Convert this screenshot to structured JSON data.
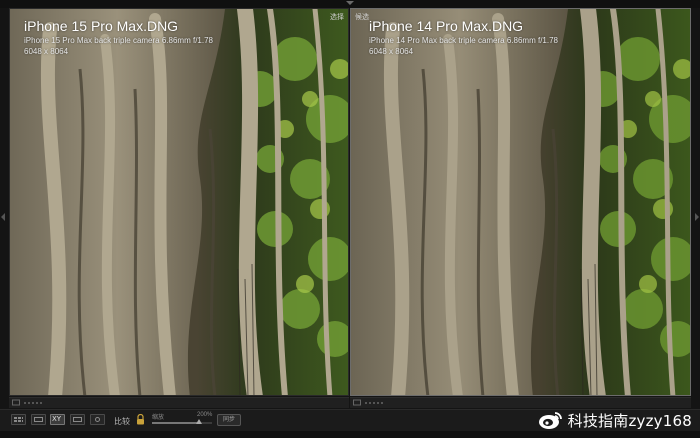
{
  "compare_view": {
    "left_pane": {
      "corner_label": "选择",
      "file_name": "iPhone 15 Pro Max.DNG",
      "camera": "iPhone 15 Pro Max back triple camera 6.86mm f/1.78",
      "dimensions": "6048 x 8064"
    },
    "right_pane": {
      "corner_label": "候选",
      "file_name": "iPhone 14 Pro Max.DNG",
      "camera": "iPhone 14 Pro Max back triple camera 6.86mm f/1.78",
      "dimensions": "6048 x 8064"
    }
  },
  "toolbar": {
    "compare_label": "比较",
    "sync_label": "缩放",
    "zoom_value": "200%",
    "zoom_level": 0.78,
    "sync_button": "同步",
    "icons": [
      "grid-view-icon",
      "loupe-view-icon",
      "compare-view-icon",
      "survey-view-icon",
      "people-view-icon",
      "lock-icon"
    ]
  },
  "watermark": {
    "text": "科技指南zyzy168",
    "logo": "weibo-logo"
  },
  "colors": {
    "background": "#141414",
    "toolbar": "#1b1b1b",
    "text": "#f2f2f2",
    "foliage": "#6f9a34",
    "trunk": "#8a826e"
  }
}
